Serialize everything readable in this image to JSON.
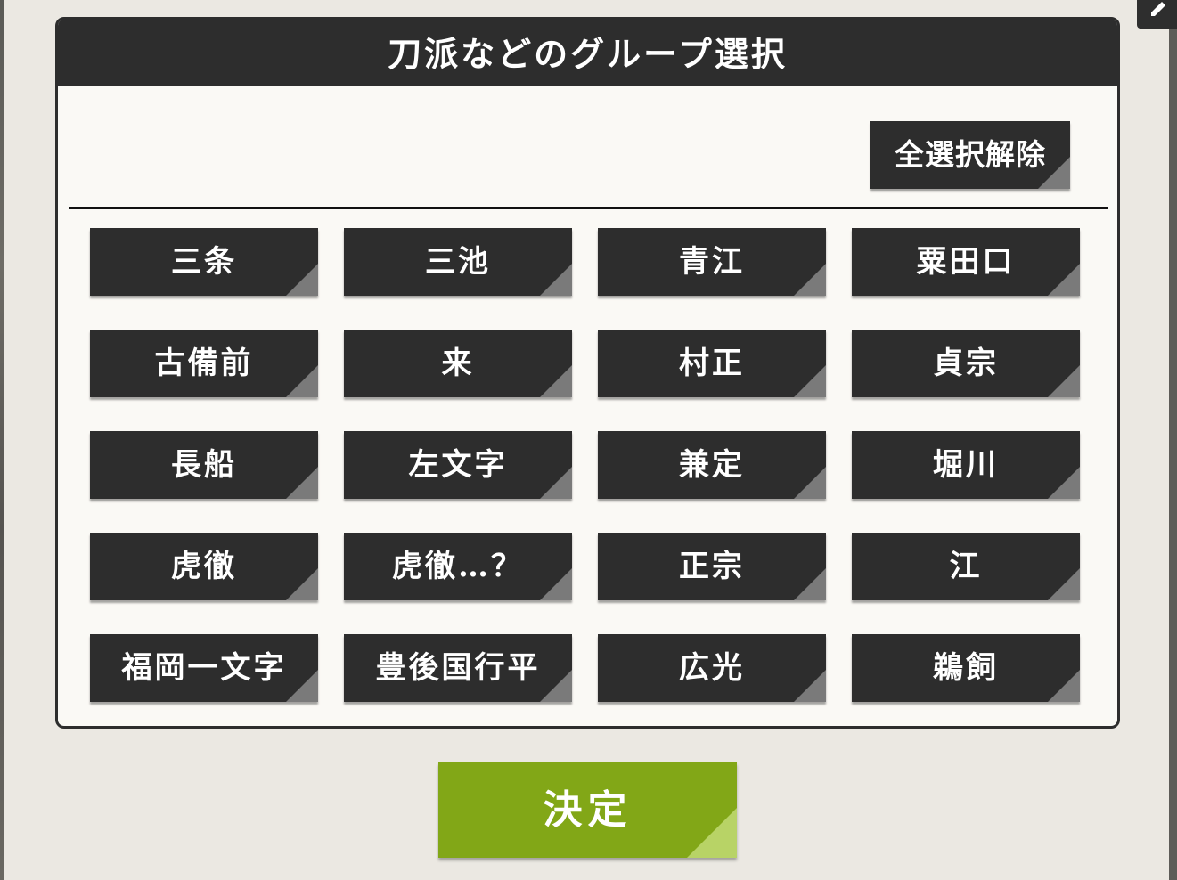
{
  "dialog": {
    "title": "刀派などのグループ選択",
    "deselect_all_label": "全選択解除",
    "groups": [
      "三条",
      "三池",
      "青江",
      "粟田口",
      "古備前",
      "来",
      "村正",
      "貞宗",
      "長船",
      "左文字",
      "兼定",
      "堀川",
      "虎徹",
      "虎徹…？",
      "正宗",
      "江",
      "福岡一文字",
      "豊後国行平",
      "広光",
      "鵜飼"
    ]
  },
  "confirm_label": "決定",
  "corner_button_icon": "edit-icon",
  "colors": {
    "button_dark": "#2d2d2d",
    "confirm_green": "#82a717",
    "panel_bg": "#faf9f5",
    "page_bg": "#ebe8e2"
  }
}
